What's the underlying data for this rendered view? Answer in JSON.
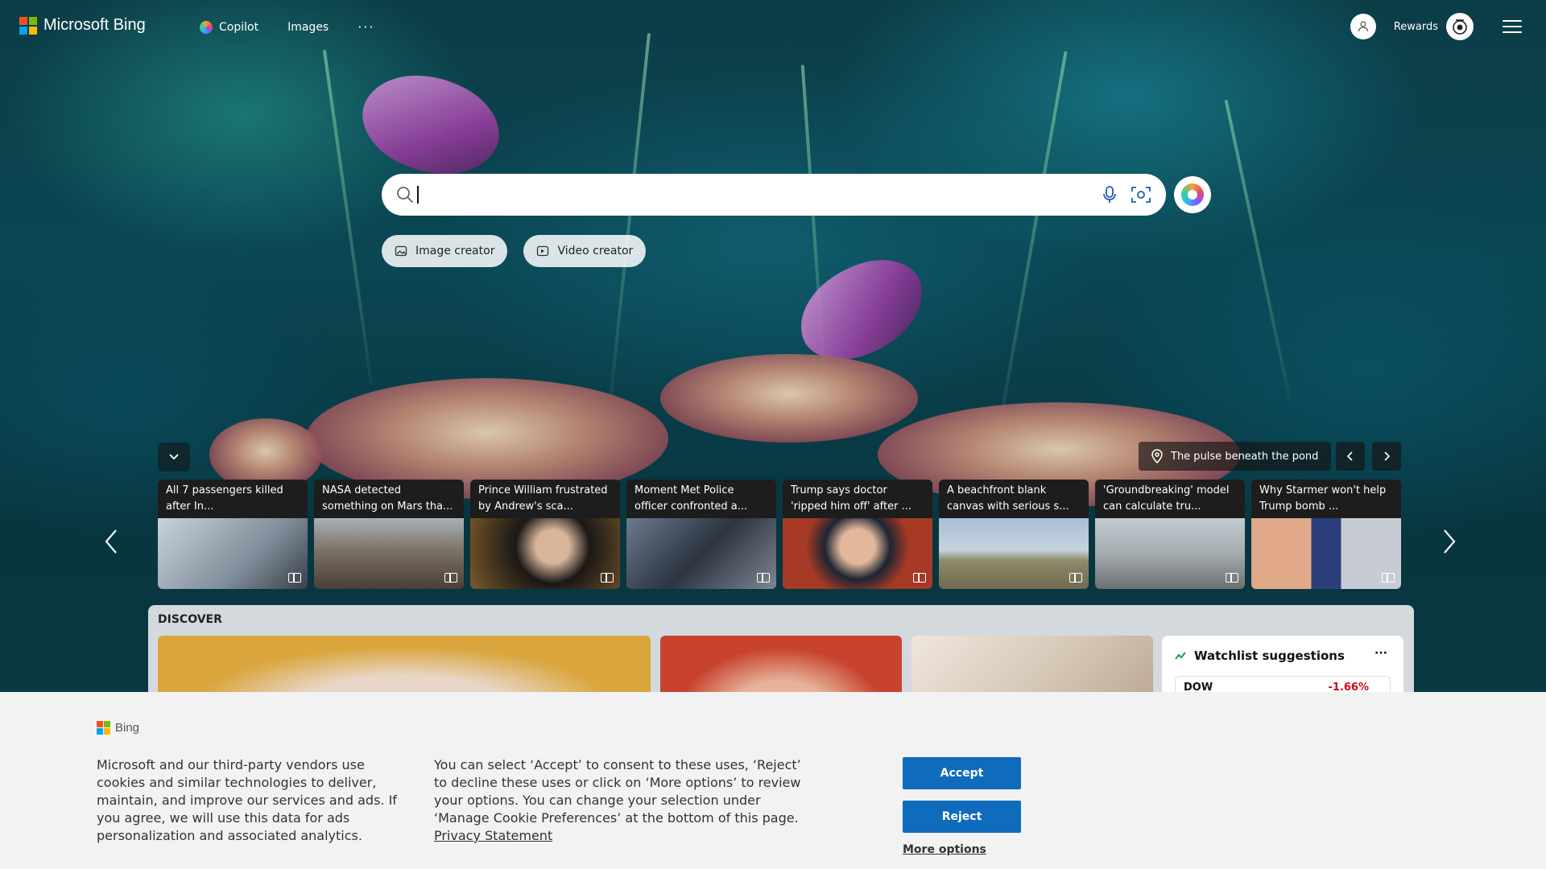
{
  "header": {
    "brand": "Microsoft Bing",
    "nav": [
      {
        "label": "Copilot",
        "icon": "copilot-icon"
      },
      {
        "label": "Images"
      }
    ],
    "more": "···",
    "rewards_label": "Rewards"
  },
  "search": {
    "value": "",
    "placeholder": ""
  },
  "chips": [
    {
      "label": "Image creator",
      "icon": "image-creator-icon"
    },
    {
      "label": "Video creator",
      "icon": "video-creator-icon"
    }
  ],
  "image_of_day": {
    "location_title": "The pulse beneath the pond"
  },
  "news": [
    {
      "title": "All 7 passengers killed after In...",
      "thumb": "#8a9aa8"
    },
    {
      "title": "NASA detected something on Mars tha...",
      "thumb": "#6e6258"
    },
    {
      "title": "Prince William frustrated by Andrew's sca...",
      "thumb": "#2a2420"
    },
    {
      "title": "Moment Met Police officer confronted a...",
      "thumb": "#4f5866"
    },
    {
      "title": "Trump says doctor 'ripped him off' after ...",
      "thumb": "#b0432c"
    },
    {
      "title": "A beachfront blank canvas with serious s...",
      "thumb": "#8fa2b4"
    },
    {
      "title": "'Groundbreaking' model can calculate tru...",
      "thumb": "#9aa4a8"
    },
    {
      "title": "Why Starmer won't help Trump bomb ...",
      "thumb": "#4b5f8e"
    }
  ],
  "discover": {
    "label": "DISCOVER",
    "cards": [
      {
        "color": "#d9a53c"
      },
      {
        "color": "#c8432e"
      },
      {
        "color": "#d7c9b8"
      }
    ]
  },
  "watchlist": {
    "title": "Watchlist suggestions",
    "more": "···",
    "rows": [
      {
        "symbol": "DOW",
        "change": "-1.66%"
      }
    ]
  },
  "cookie": {
    "brand": "Bing",
    "text_left": "Microsoft and our third-party vendors use cookies and similar technologies to deliver, maintain, and improve our services and ads. If you agree, we will use this data for ads personalization and associated analytics.",
    "text_right": "You can select ‘Accept’ to consent to these uses, ‘Reject’ to decline these uses or click on ‘More options’ to review your options. You can change your selection under ‘Manage Cookie Preferences’ at the bottom of this page.",
    "privacy_link": "Privacy Statement",
    "accept": "Accept",
    "reject": "Reject",
    "more_options": "More options"
  },
  "colors": {
    "accent": "#0f6cbd",
    "negative": "#d0021b",
    "ms_red": "#f25022",
    "ms_green": "#7fba00",
    "ms_blue": "#00a4ef",
    "ms_yellow": "#ffb900"
  }
}
